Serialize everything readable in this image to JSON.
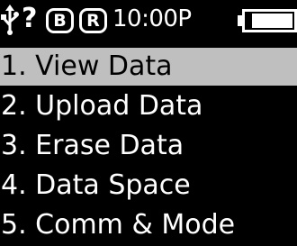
{
  "status_bar": {
    "usb_icon": "usb-icon",
    "question_mark": "?",
    "badges": [
      "B",
      "R"
    ],
    "time": "10:00P",
    "battery_icon": "battery-icon",
    "battery_level": 0.85
  },
  "menu": {
    "selected_index": 0,
    "items": [
      {
        "label": "1.  View Data"
      },
      {
        "label": "2.  Upload Data"
      },
      {
        "label": "3.  Erase Data"
      },
      {
        "label": "4.  Data Space"
      },
      {
        "label": "5.  Comm & Mode"
      }
    ]
  },
  "colors": {
    "background": "#000000",
    "foreground": "#ffffff",
    "selection": "#bfbfbf",
    "selected_text": "#000000"
  }
}
